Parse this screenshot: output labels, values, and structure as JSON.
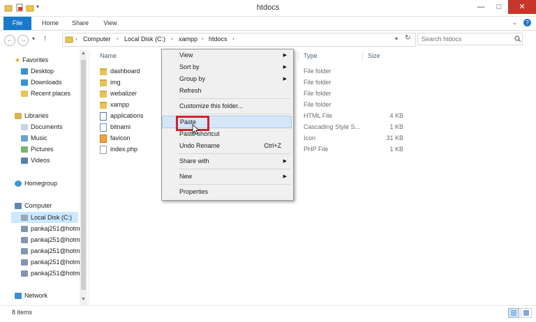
{
  "window": {
    "title": "htdocs"
  },
  "window_controls": {
    "minimize": "—",
    "maximize": "□",
    "close": "✕"
  },
  "ribbon": {
    "tabs": [
      "File",
      "Home",
      "Share",
      "View"
    ]
  },
  "nav": {
    "back": "←",
    "forward": "→",
    "recent": "▾",
    "up": "↑"
  },
  "address": {
    "crumbs": [
      "Computer",
      "Local Disk (C:)",
      "xampp",
      "htdocs"
    ],
    "separator": "›",
    "dropdown": "▾",
    "refresh": "↻"
  },
  "search": {
    "placeholder": "Search htdocs",
    "icon": "search-icon"
  },
  "sidebar": {
    "favorites": {
      "label": "Favorites",
      "items": [
        "Desktop",
        "Downloads",
        "Recent places"
      ]
    },
    "libraries": {
      "label": "Libraries",
      "items": [
        "Documents",
        "Music",
        "Pictures",
        "Videos"
      ]
    },
    "homegroup": "Homegroup",
    "computer": {
      "label": "Computer",
      "items": [
        "Local Disk (C:)",
        "pankaj251@hotm",
        "pankaj251@hotm",
        "pankaj251@hotm",
        "pankaj251@hotm",
        "pankaj251@hotm"
      ]
    },
    "network": "Network"
  },
  "columns": {
    "name": "Name",
    "type": "Type",
    "size": "Size"
  },
  "files": [
    {
      "name": "dashboard",
      "type": "File folder",
      "size": "",
      "kind": "folder"
    },
    {
      "name": "img",
      "type": "File folder",
      "size": "",
      "kind": "folder"
    },
    {
      "name": "webalizer",
      "type": "File folder",
      "size": "",
      "kind": "folder"
    },
    {
      "name": "xampp",
      "type": "File folder",
      "size": "",
      "kind": "folder"
    },
    {
      "name": "applications",
      "type": "HTML File",
      "size": "4 KB",
      "kind": "file"
    },
    {
      "name": "bitnami",
      "type": "Cascading Style S...",
      "size": "1 KB",
      "kind": "file"
    },
    {
      "name": "favicon",
      "type": "Icon",
      "size": "31 KB",
      "kind": "file"
    },
    {
      "name": "index.php",
      "type": "PHP File",
      "size": "1 KB",
      "kind": "file"
    }
  ],
  "status": {
    "items_count": "8 items"
  },
  "context_menu": {
    "view": "View",
    "sort_by": "Sort by",
    "group_by": "Group by",
    "refresh": "Refresh",
    "customize": "Customize this folder...",
    "paste": "Paste",
    "paste_shortcut": "Paste shortcut",
    "undo_rename": "Undo Rename",
    "undo_shortcut": "Ctrl+Z",
    "share_with": "Share with",
    "new": "New",
    "properties": "Properties",
    "submenu_arrow": "▶"
  },
  "colors": {
    "accent": "#1979ca",
    "highlight": "#d2202a",
    "close": "#c7362a"
  }
}
